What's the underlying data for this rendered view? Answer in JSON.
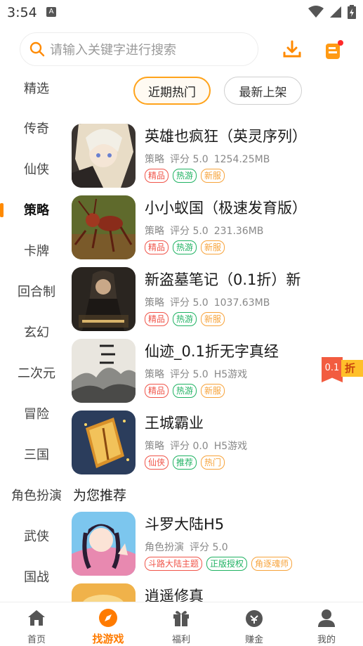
{
  "status_bar": {
    "time": "3:54",
    "notif_letter": "A"
  },
  "search": {
    "placeholder": "请输入关键字进行搜索"
  },
  "sidebar": {
    "items": [
      "精选",
      "传奇",
      "仙侠",
      "策略",
      "卡牌",
      "回合制",
      "玄幻",
      "二次元",
      "冒险",
      "三国",
      "角色扮演",
      "武侠",
      "国战"
    ],
    "active": "策略"
  },
  "filters": {
    "hot": "近期热门",
    "new": "最新上架"
  },
  "games": [
    {
      "title": "英雄也疯狂（英灵序列）",
      "category": "策略",
      "rating": "评分 5.0",
      "size": "1254.25MB",
      "tags": [
        "精品",
        "热游",
        "新服"
      ]
    },
    {
      "title": "小小蚁国（极速发育版）",
      "category": "策略",
      "rating": "评分 5.0",
      "size": "231.36MB",
      "tags": [
        "精品",
        "热游",
        "新服"
      ]
    },
    {
      "title": "新盗墓笔记（0.1折）新",
      "category": "策略",
      "rating": "评分 5.0",
      "size": "1037.63MB",
      "tags": [
        "精品",
        "热游",
        "新服"
      ]
    },
    {
      "title": "仙迹_0.1折无字真经",
      "category": "策略",
      "rating": "评分 5.0",
      "size": "H5游戏",
      "tags": [
        "精品",
        "热游",
        "新服"
      ]
    },
    {
      "title": "王城霸业",
      "category": "策略",
      "rating": "评分 0.0",
      "size": "H5游戏",
      "tags": [
        "仙侠",
        "推荐",
        "热门"
      ]
    }
  ],
  "recommend": {
    "title": "为您推荐",
    "games": [
      {
        "title": "斗罗大陆H5",
        "category": "角色扮演",
        "rating": "评分 5.0",
        "tags": [
          "斗路大陆主题",
          "正版授权",
          "角逐魂师"
        ]
      },
      {
        "title": "逍遥修真"
      }
    ]
  },
  "discount_badge": {
    "value": "0.1",
    "unit": "折"
  },
  "bottom_nav": [
    {
      "label": "首页",
      "icon": "home-icon"
    },
    {
      "label": "找游戏",
      "icon": "compass-icon"
    },
    {
      "label": "福利",
      "icon": "gift-icon"
    },
    {
      "label": "赚金",
      "icon": "money-bag-icon"
    },
    {
      "label": "我的",
      "icon": "profile-icon"
    }
  ],
  "colors": {
    "accent": "#ff8a00",
    "tag_red": "#f0554a",
    "tag_green": "#1fb262",
    "tag_orange": "#f7a33b"
  }
}
